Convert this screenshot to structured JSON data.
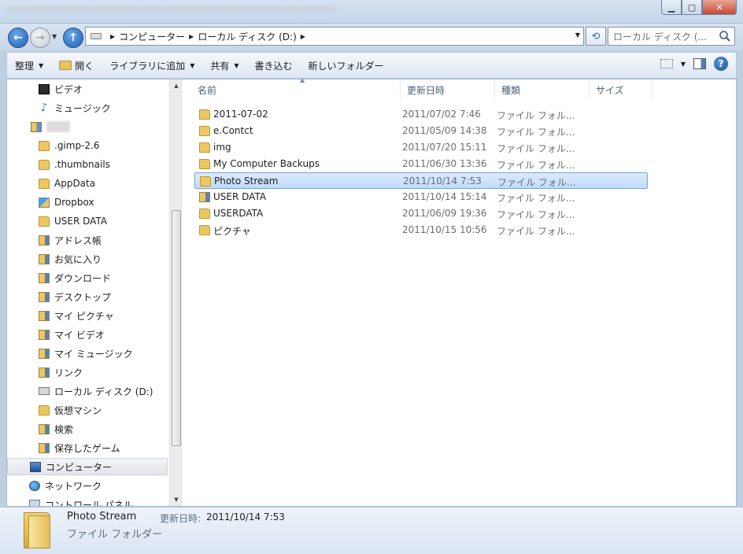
{
  "address": {
    "crumbs": [
      "コンピューター",
      "ローカル ディスク (D:)"
    ],
    "search_placeholder": "ローカル ディスク (..."
  },
  "toolbar": {
    "organize": "整理",
    "open": "開く",
    "include_library": "ライブラリに追加",
    "share": "共有",
    "burn": "書き込む",
    "new_folder": "新しいフォルダー"
  },
  "nav": {
    "items": [
      {
        "label": "ビデオ",
        "icon": "video-icon"
      },
      {
        "label": "ミュージック",
        "icon": "music-icon"
      },
      {
        "label": "",
        "icon": "user-folder-icon"
      },
      {
        "label": ".gimp-2.6",
        "icon": "folder-icon"
      },
      {
        "label": ".thumbnails",
        "icon": "folder-icon"
      },
      {
        "label": "AppData",
        "icon": "folder-icon"
      },
      {
        "label": "Dropbox",
        "icon": "dropbox-folder-icon"
      },
      {
        "label": "USER DATA",
        "icon": "folder-icon"
      },
      {
        "label": "アドレス帳",
        "icon": "contacts-folder-icon"
      },
      {
        "label": "お気に入り",
        "icon": "favorites-folder-icon"
      },
      {
        "label": "ダウンロード",
        "icon": "downloads-folder-icon"
      },
      {
        "label": "デスクトップ",
        "icon": "desktop-folder-icon"
      },
      {
        "label": "マイ ピクチャ",
        "icon": "pictures-folder-icon"
      },
      {
        "label": "マイ ビデオ",
        "icon": "videos-folder-icon"
      },
      {
        "label": "マイ ミュージック",
        "icon": "music-folder-icon"
      },
      {
        "label": "リンク",
        "icon": "links-folder-icon"
      },
      {
        "label": "ローカル ディスク (D:)",
        "icon": "drive-icon"
      },
      {
        "label": "仮想マシン",
        "icon": "folder-icon"
      },
      {
        "label": "検索",
        "icon": "search-folder-icon"
      },
      {
        "label": "保存したゲーム",
        "icon": "games-folder-icon"
      },
      {
        "label": "コンピューター",
        "icon": "computer-icon"
      },
      {
        "label": "ネットワーク",
        "icon": "network-icon"
      },
      {
        "label": "コントロール パネル",
        "icon": "control-panel-icon"
      }
    ]
  },
  "columns": {
    "name": "名前",
    "modified": "更新日時",
    "type": "種類",
    "size": "サイズ"
  },
  "files": [
    {
      "name": "2011-07-02",
      "modified": "2011/07/02 7:46",
      "type": "ファイル フォル..."
    },
    {
      "name": "e.Contct",
      "modified": "2011/05/09 14:38",
      "type": "ファイル フォル..."
    },
    {
      "name": "img",
      "modified": "2011/07/20 15:11",
      "type": "ファイル フォル..."
    },
    {
      "name": "My Computer Backups",
      "modified": "2011/06/30 13:36",
      "type": "ファイル フォル..."
    },
    {
      "name": "Photo Stream",
      "modified": "2011/10/14 7:53",
      "type": "ファイル フォル..."
    },
    {
      "name": "USER DATA",
      "modified": "2011/10/14 15:14",
      "type": "ファイル フォル..."
    },
    {
      "name": "USERDATA",
      "modified": "2011/06/09 19:36",
      "type": "ファイル フォル..."
    },
    {
      "name": "ピクチャ",
      "modified": "2011/10/15 10:56",
      "type": "ファイル フォル..."
    }
  ],
  "details": {
    "name": "Photo Stream",
    "type": "ファイル フォルダー",
    "modified_label": "更新日時:",
    "modified_value": "2011/10/14 7:53"
  },
  "colors": {
    "selection": "#c1dbfc",
    "folder": "#ecc762"
  }
}
